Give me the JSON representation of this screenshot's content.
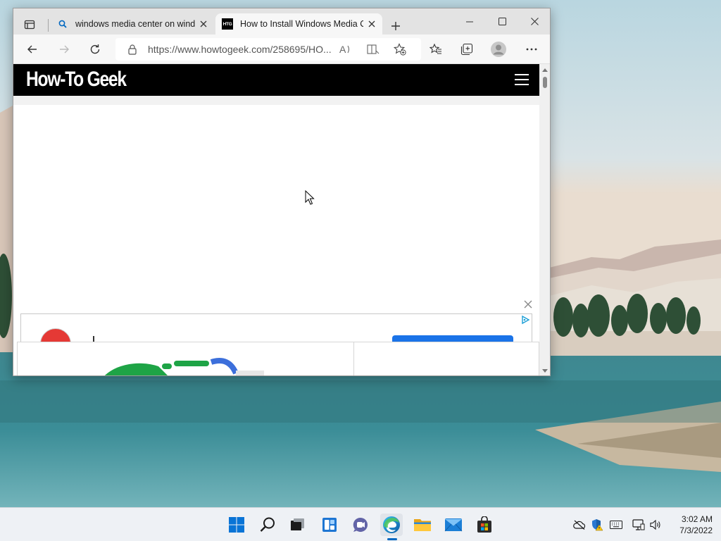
{
  "browser": {
    "tabs": [
      {
        "title": "windows media center on windo",
        "active": false,
        "favicon": "search-icon"
      },
      {
        "title": "How to Install Windows Media C",
        "active": true,
        "favicon": "htg-favicon"
      }
    ],
    "favicon_text": "HTG",
    "address": "https://www.howtogeek.com/258695/HO...",
    "toolbar_icons": [
      "back-icon",
      "forward-icon",
      "refresh-icon",
      "lock-icon",
      "read-aloud-icon",
      "immersive-reader-icon",
      "add-favorite-icon",
      "favorites-icon",
      "collections-icon",
      "profile-icon",
      "more-icon"
    ],
    "window_controls": [
      "minimize-icon",
      "maximize-icon",
      "close-icon"
    ]
  },
  "site": {
    "logo": "How-To Geek",
    "menu_icon": "hamburger-icon"
  },
  "taskbar": {
    "apps": [
      "start-icon",
      "search-icon",
      "task-view-icon",
      "widgets-icon",
      "teams-chat-icon",
      "edge-icon",
      "file-explorer-icon",
      "mail-icon",
      "store-icon"
    ],
    "active_app": "edge-icon",
    "tray": [
      "onedrive-icon",
      "security-warning-icon",
      "keyboard-icon",
      "network-icon",
      "volume-icon"
    ],
    "time": "3:02 AM",
    "date": "7/3/2022"
  },
  "colors": {
    "accent": "#0067c0",
    "header_bg": "#000000",
    "tabstrip_bg": "#e3e3e3"
  }
}
